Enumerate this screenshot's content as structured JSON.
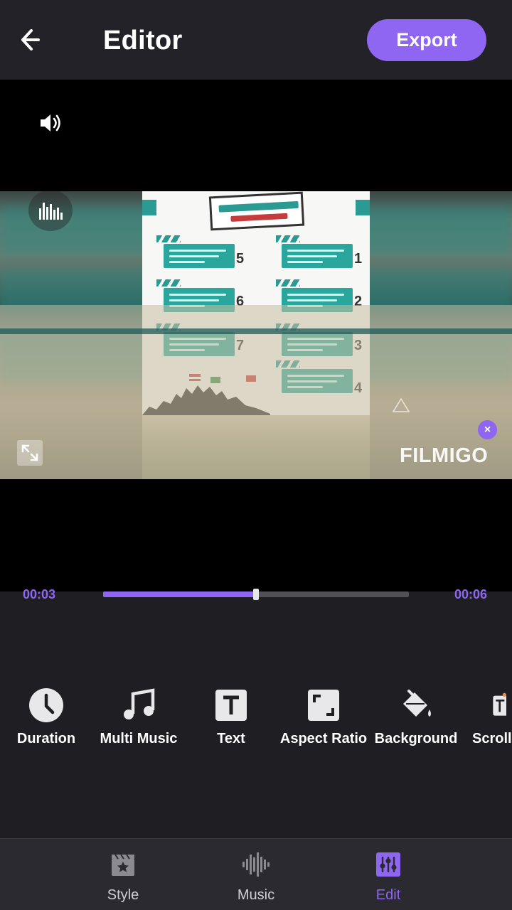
{
  "header": {
    "title": "Editor",
    "export_label": "Export",
    "back_icon": "arrow-left-icon"
  },
  "preview": {
    "volume_icon": "volume-icon",
    "equalizer_icon": "equalizer-icon",
    "expand_icon": "expand-icon",
    "watermark": "FILMIGO",
    "watermark_close": "×",
    "poster_numbers": [
      "5",
      "1",
      "6",
      "2",
      "7",
      "3",
      "4"
    ]
  },
  "timeline": {
    "current": "00:03",
    "total": "00:06",
    "progress": 0.5
  },
  "tools": [
    {
      "label": "Duration",
      "icon": "clock-icon"
    },
    {
      "label": "Multi Music",
      "icon": "music-note-icon"
    },
    {
      "label": "Text",
      "icon": "text-icon"
    },
    {
      "label": "Aspect Ratio",
      "icon": "aspect-ratio-icon"
    },
    {
      "label": "Background",
      "icon": "paint-bucket-icon"
    },
    {
      "label": "Scroll",
      "icon": "scroll-text-icon"
    }
  ],
  "nav": [
    {
      "label": "Style",
      "icon": "clapperboard-star-icon",
      "active": false
    },
    {
      "label": "Music",
      "icon": "waveform-icon",
      "active": false
    },
    {
      "label": "Edit",
      "icon": "sliders-icon",
      "active": true
    }
  ],
  "colors": {
    "accent": "#8f66f2",
    "background": "#1e1e23",
    "topbar": "#222228",
    "teal": "#2b9a93"
  }
}
